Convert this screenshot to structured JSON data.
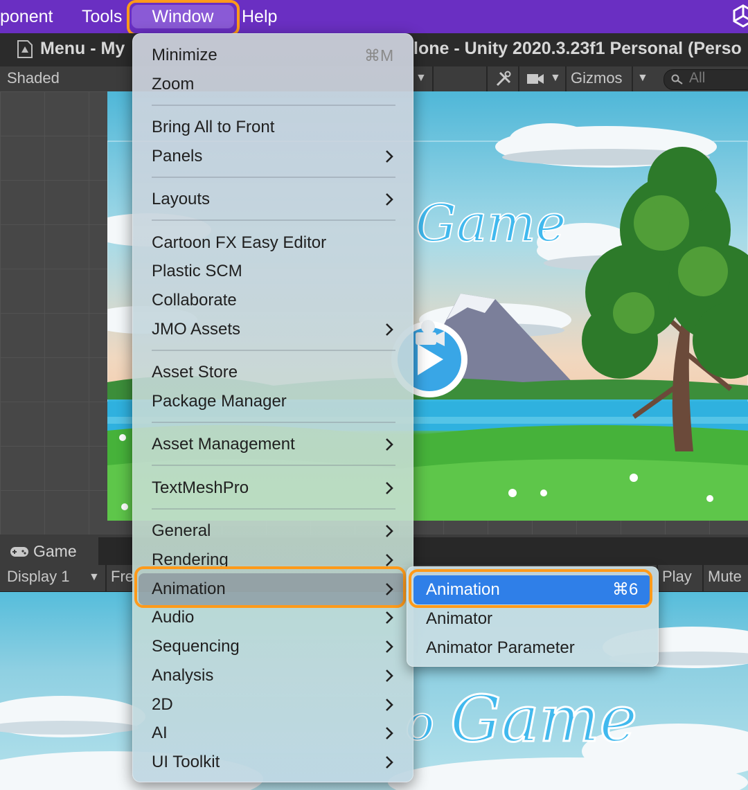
{
  "menubar": {
    "items": [
      "ponent",
      "Tools",
      "Window",
      "Help"
    ],
    "logo_icon": "unity-logo-icon",
    "highlight_color": "#ff9a1a"
  },
  "titlebar": {
    "left": "Menu - My",
    "right": "lone - Unity 2020.3.23f1 Personal (Perso"
  },
  "scene_toolbar": {
    "shading": "Shaded",
    "gizmos": "Gizmos",
    "search_placeholder": "All"
  },
  "scene_art": {
    "title_text": "Game"
  },
  "game_panel": {
    "tab_label": "Game",
    "display": "Display 1",
    "aspect_partial": "Fre",
    "play_label": "Play",
    "mute_label": "Mute",
    "title_text": "Game",
    "title_prefix": "o"
  },
  "window_menu": {
    "items": [
      {
        "label": "Minimize",
        "shortcut": "⌘M"
      },
      {
        "label": "Zoom"
      },
      {
        "label": "Bring All to Front"
      },
      {
        "label": "Panels",
        "submenu": true
      },
      {
        "label": "Layouts",
        "submenu": true
      },
      {
        "label": "Cartoon FX Easy Editor"
      },
      {
        "label": "Plastic SCM"
      },
      {
        "label": "Collaborate"
      },
      {
        "label": "JMO Assets",
        "submenu": true
      },
      {
        "label": "Asset Store"
      },
      {
        "label": "Package Manager"
      },
      {
        "label": "Asset Management",
        "submenu": true
      },
      {
        "label": "TextMeshPro",
        "submenu": true
      },
      {
        "label": "General",
        "submenu": true
      },
      {
        "label": "Rendering",
        "submenu": true
      },
      {
        "label": "Animation",
        "submenu": true,
        "selected": true
      },
      {
        "label": "Audio",
        "submenu": true
      },
      {
        "label": "Sequencing",
        "submenu": true
      },
      {
        "label": "Analysis",
        "submenu": true
      },
      {
        "label": "2D",
        "submenu": true
      },
      {
        "label": "AI",
        "submenu": true
      },
      {
        "label": "UI Toolkit",
        "submenu": true
      }
    ]
  },
  "animation_submenu": {
    "items": [
      {
        "label": "Animation",
        "shortcut": "⌘6",
        "selected": true
      },
      {
        "label": "Animator"
      },
      {
        "label": "Animator Parameter"
      }
    ],
    "selection_color": "#2f7fe8"
  }
}
